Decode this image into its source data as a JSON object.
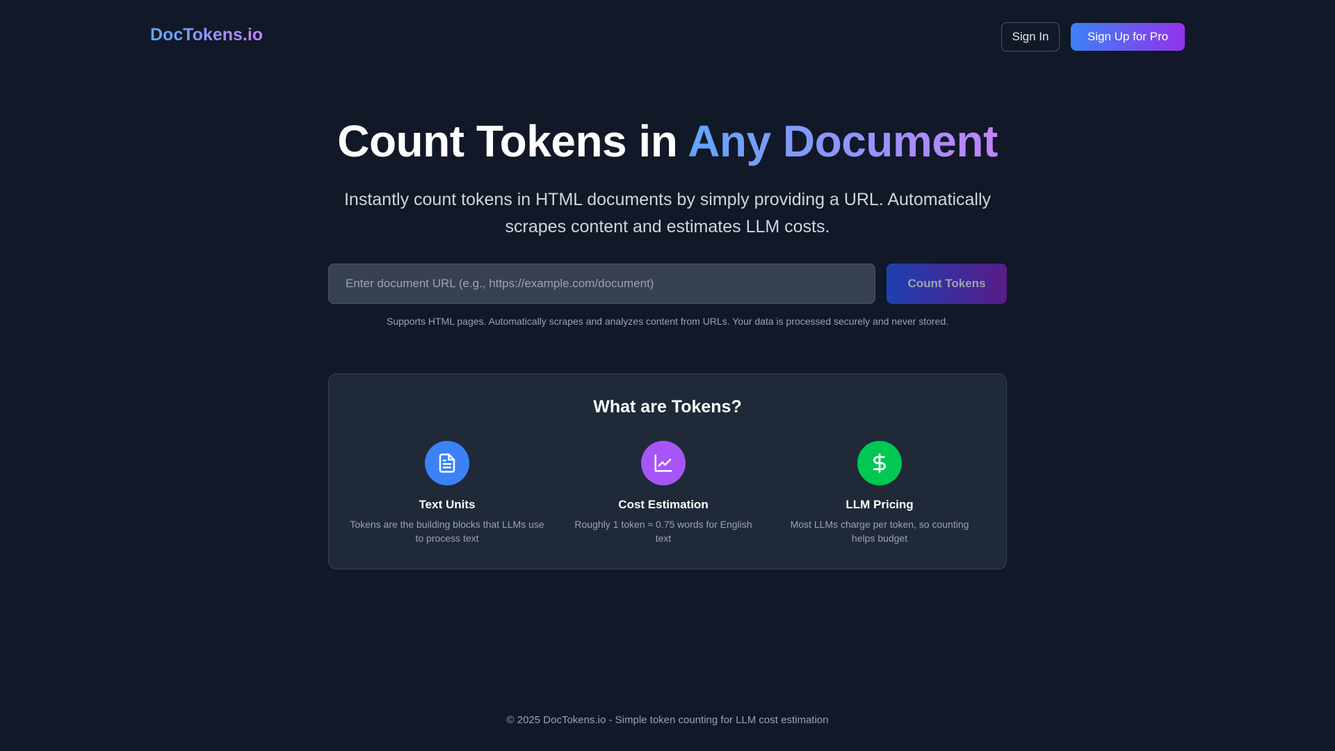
{
  "header": {
    "brand": "DocTokens.io",
    "signin_label": "Sign In",
    "signup_label": "Sign Up for Pro"
  },
  "hero": {
    "title_plain": "Count Tokens in ",
    "title_highlight": "Any Document",
    "subtitle": "Instantly count tokens in HTML documents by simply providing a URL. Automatically scrapes content and estimates LLM costs."
  },
  "search": {
    "placeholder": "Enter document URL (e.g., https://example.com/document)",
    "value": "",
    "button_label": "Count Tokens",
    "note": "Supports HTML pages. Automatically scrapes and analyzes content from URLs. Your data is processed securely and never stored."
  },
  "info_card": {
    "title": "What are Tokens?",
    "features": [
      {
        "icon": "document-icon",
        "color": "#3b82f6",
        "title": "Text Units",
        "description": "Tokens are the building blocks that LLMs use to process text"
      },
      {
        "icon": "chart-line-icon",
        "color": "#a855f7",
        "title": "Cost Estimation",
        "description": "Roughly 1 token ≈ 0.75 words for English text"
      },
      {
        "icon": "dollar-icon",
        "color": "#22c55e",
        "title": "LLM Pricing",
        "description": "Most LLMs charge per token, so counting helps budget"
      }
    ]
  },
  "footer": {
    "text": "© 2025 DocTokens.io - Simple token counting for LLM cost estimation"
  },
  "colors": {
    "background": "#111827",
    "card": "#1f2937",
    "accent_blue": "#3b82f6",
    "accent_purple": "#9333ea"
  }
}
